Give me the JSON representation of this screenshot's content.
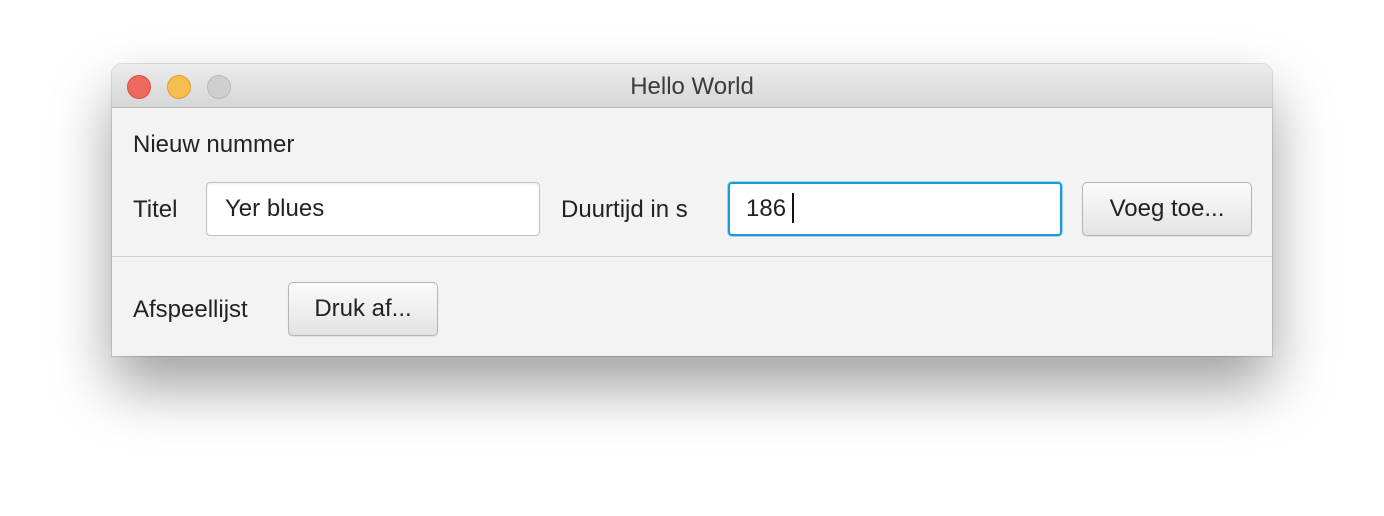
{
  "window": {
    "title": "Hello World",
    "controls": {
      "close": "close-button",
      "minimize": "minimize-button",
      "zoom": "zoom-button"
    }
  },
  "new_track": {
    "heading": "Nieuw nummer",
    "title_label": "Titel",
    "title_value": "Yer blues",
    "duration_label": "Duurtijd in s",
    "duration_value": "186",
    "add_button": "Voeg toe..."
  },
  "playlist": {
    "label": "Afspeellijst",
    "print_button": "Druk af..."
  },
  "colors": {
    "close": "#ee6a5e",
    "minimize": "#f5be4f",
    "zoom": "#cfcfcf",
    "focus_ring": "#1a9ad6"
  }
}
